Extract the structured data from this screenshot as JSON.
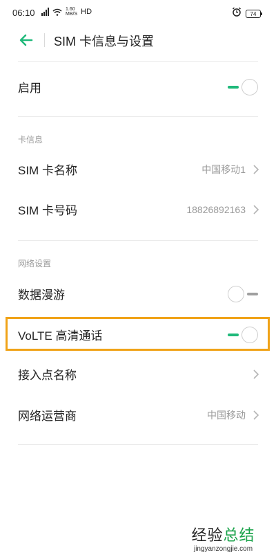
{
  "status_bar": {
    "time": "06:10",
    "speed_value": "1.60",
    "speed_unit": "MB/S",
    "network_type": "HD",
    "battery": "74",
    "icons": [
      "signal-icon",
      "wifi-icon",
      "alarm-icon",
      "battery-icon"
    ]
  },
  "header": {
    "title": "SIM 卡信息与设置",
    "back_icon": "back-arrow-icon",
    "accent_color": "#1fb97a"
  },
  "rows": {
    "enable": {
      "label": "启用",
      "toggle_on": true
    },
    "card_info_section": "卡信息",
    "sim_name": {
      "label": "SIM 卡名称",
      "value": "中国移动1"
    },
    "sim_number": {
      "label": "SIM 卡号码",
      "value": "18826892163"
    },
    "network_section": "网络设置",
    "data_roaming": {
      "label": "数据漫游",
      "toggle_on": false
    },
    "volte": {
      "label": "VoLTE 高清通话",
      "toggle_on": true
    },
    "apn": {
      "label": "接入点名称"
    },
    "carrier": {
      "label": "网络运营商",
      "value": "中国移动"
    }
  },
  "highlight_color": "#f0a318",
  "watermark": {
    "part1": "经验",
    "part2": "总结",
    "url": "jingyanzongjie.com"
  }
}
